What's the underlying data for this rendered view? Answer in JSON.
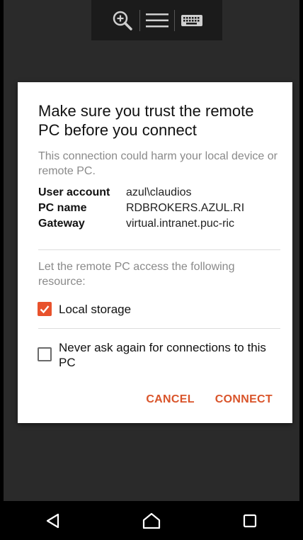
{
  "toolbar": {
    "zoom_icon": "zoom-in-icon",
    "menu_icon": "menu-icon",
    "keyboard_icon": "keyboard-icon"
  },
  "dialog": {
    "title": "Make sure you trust the remote PC before you connect",
    "warning": "This connection could harm your local device or remote PC.",
    "details": [
      {
        "label": "User account",
        "value": "azul\\claudios"
      },
      {
        "label": "PC name",
        "value": "RDBROKERS.AZUL.RI"
      },
      {
        "label": "Gateway",
        "value": "virtual.intranet.puc-ric"
      }
    ],
    "resource_prompt": "Let the remote PC access the following resource:",
    "local_storage": {
      "label": "Local storage",
      "checked": true
    },
    "never_ask": {
      "label": "Never ask again for connections to this PC",
      "checked": false
    },
    "cancel_label": "CANCEL",
    "connect_label": "CONNECT"
  },
  "colors": {
    "accent": "#e8522c",
    "button_text": "#d9542a",
    "backdrop": "#2a2a2a"
  },
  "navbar": {
    "back_icon": "back-triangle-icon",
    "home_icon": "home-icon",
    "recents_icon": "recents-square-icon"
  }
}
